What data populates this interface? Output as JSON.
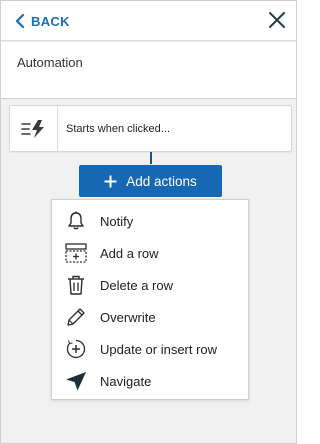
{
  "header": {
    "back_label": "BACK",
    "back_icon": "chevron-left-icon",
    "close_icon": "close-icon"
  },
  "title": "Automation",
  "trigger": {
    "icon": "lightning-lines-icon",
    "label": "Starts when clicked..."
  },
  "add_actions": {
    "icon": "plus-icon",
    "label": "Add actions"
  },
  "menu": {
    "items": [
      {
        "icon": "bell-icon",
        "label": "Notify"
      },
      {
        "icon": "add-row-icon",
        "label": "Add a row"
      },
      {
        "icon": "trash-icon",
        "label": "Delete a row"
      },
      {
        "icon": "pencil-icon",
        "label": "Overwrite"
      },
      {
        "icon": "circle-plus-icon",
        "label": "Update or insert row"
      },
      {
        "icon": "navigate-arrow-icon",
        "label": "Navigate"
      }
    ]
  },
  "colors": {
    "accent": "#1768b3",
    "link": "#1a6fb5",
    "background": "#f1f1f1"
  }
}
